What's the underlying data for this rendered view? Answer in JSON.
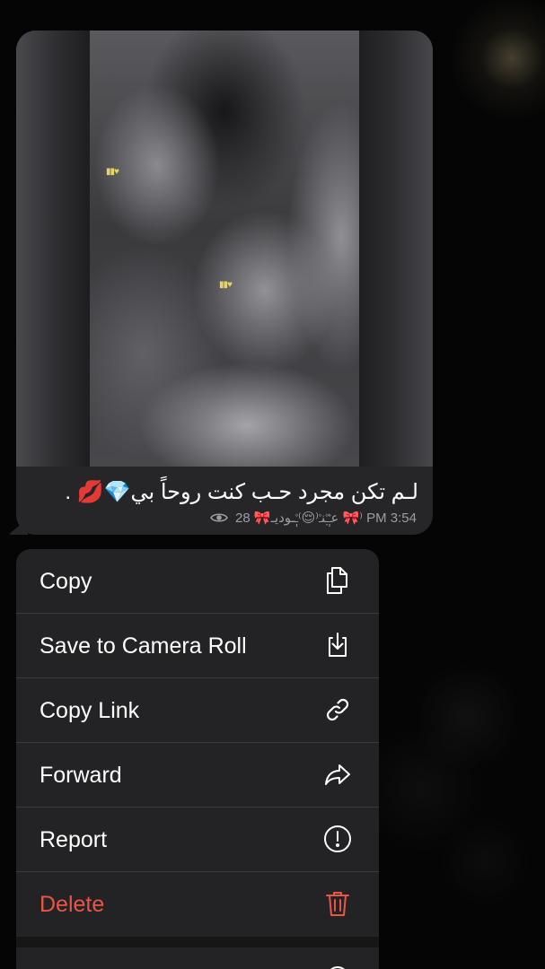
{
  "message": {
    "caption": "لـم تكن مجرد حـب كنت روحاً بي💎💋 .",
    "meta_text": "28 🎀عـٰٜٜ۫ـٜ۫نـ۫⁽😌⁾ـٜٜ۫ـوديـ 🎀⁾ PM 3:54",
    "views_icon": "eye-icon",
    "sticker_1": "▮▮♥",
    "sticker_2": "▮▮♥",
    "bubble_color": "#262628"
  },
  "menu": {
    "items": [
      {
        "label": "Copy",
        "icon": "copy-icon",
        "color": "#ffffff"
      },
      {
        "label": "Save to Camera Roll",
        "icon": "save-download-icon",
        "color": "#ffffff"
      },
      {
        "label": "Copy Link",
        "icon": "link-icon",
        "color": "#ffffff"
      },
      {
        "label": "Forward",
        "icon": "forward-arrow-icon",
        "color": "#ffffff"
      },
      {
        "label": "Report",
        "icon": "report-exclamation-icon",
        "color": "#ffffff"
      },
      {
        "label": "Delete",
        "icon": "trash-icon",
        "color": "#eb5545"
      }
    ]
  },
  "colors": {
    "menu_background": "#232325",
    "danger": "#eb5545",
    "separator": "#3a3a3c"
  }
}
